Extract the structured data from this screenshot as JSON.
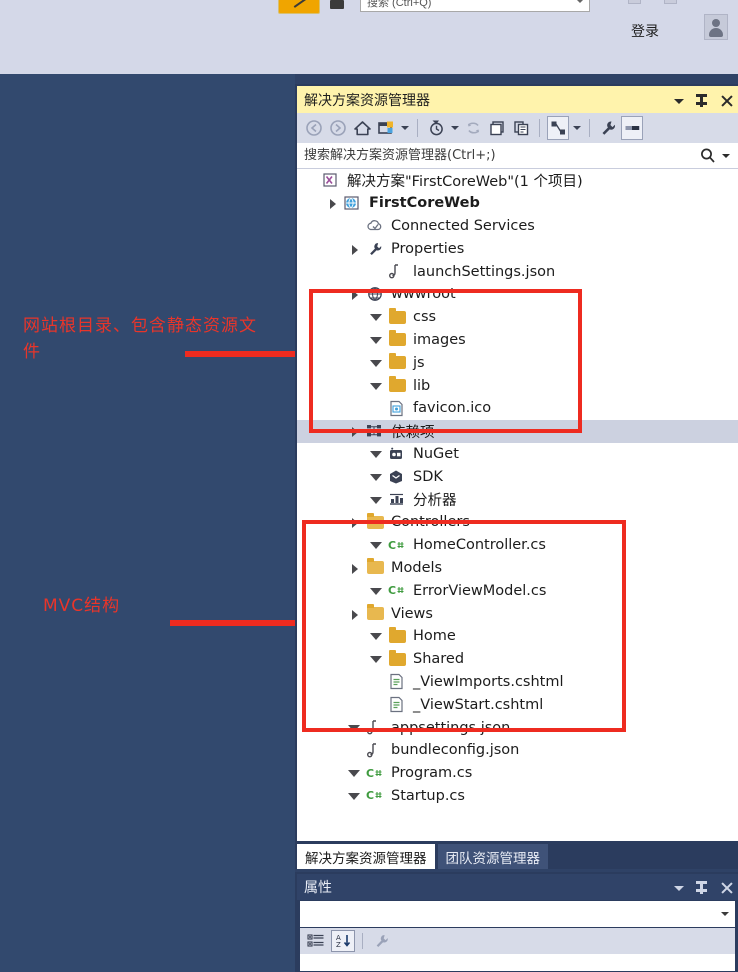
{
  "top_bar": {
    "search_value": "搜索 (Ctrl+Q)",
    "login_label": "登录",
    "account_icon": "account-person-icon"
  },
  "annotations": [
    {
      "id": "wwwroot-note",
      "text": "网站根目录、包含静态资源文件",
      "color": "#e8352a"
    },
    {
      "id": "mvc-note",
      "text": "MVC结构",
      "color": "#e8352a"
    }
  ],
  "solution_explorer": {
    "title": "解决方案资源管理器",
    "title_buttons": [
      {
        "name": "window-menu-chevron",
        "icon": "chevron-down-icon"
      },
      {
        "name": "auto-hide-pin",
        "icon": "pin-icon"
      },
      {
        "name": "close-window",
        "icon": "close-icon"
      }
    ],
    "toolbar": [
      {
        "name": "back",
        "icon": "arrow-back-icon"
      },
      {
        "name": "forward",
        "icon": "arrow-forward-icon"
      },
      {
        "name": "home",
        "icon": "home-icon"
      },
      {
        "name": "show-all-files",
        "icon": "show-all-files-icon"
      },
      {
        "name": "show-all-files-dropdown",
        "icon": "chevron-down-icon"
      },
      {
        "name": "pending-changes-filter",
        "icon": "clock-filter-icon"
      },
      {
        "name": "pending-changes-dropdown",
        "icon": "chevron-down-icon"
      },
      {
        "name": "refresh",
        "icon": "refresh-icon"
      },
      {
        "name": "collapse-all",
        "icon": "collapse-all-icon"
      },
      {
        "name": "view-code",
        "icon": "view-code-icon"
      },
      {
        "name": "preview-selected-items",
        "icon": "preview-items-icon"
      },
      {
        "name": "preview-dropdown",
        "icon": "chevron-down-icon"
      },
      {
        "name": "properties",
        "icon": "wrench-icon"
      },
      {
        "name": "properties-window",
        "icon": "properties-panel-icon"
      }
    ],
    "search_placeholder": "搜索解决方案资源管理器(Ctrl+;)",
    "search_value": "",
    "search_icon": "search-icon",
    "search_dropdown_icon": "chevron-down-icon",
    "tree": [
      {
        "label": "解决方案\"FirstCoreWeb\"(1 个项目)",
        "indent": 0,
        "toggle": "none",
        "icon": "solution-icon",
        "bold": false,
        "selected": false
      },
      {
        "label": "FirstCoreWeb",
        "indent": 1,
        "toggle": "expanded",
        "icon": "web-project-icon",
        "bold": true,
        "selected": false
      },
      {
        "label": "Connected Services",
        "indent": 2,
        "toggle": "none",
        "icon": "connected-services-icon",
        "bold": false,
        "selected": false
      },
      {
        "label": "Properties",
        "indent": 2,
        "toggle": "expanded",
        "icon": "wrench-icon",
        "bold": false,
        "selected": false
      },
      {
        "label": "launchSettings.json",
        "indent": 3,
        "toggle": "none",
        "icon": "json-file-icon",
        "bold": false,
        "selected": false
      },
      {
        "label": "wwwroot",
        "indent": 2,
        "toggle": "expanded",
        "icon": "globe-icon",
        "bold": false,
        "selected": false
      },
      {
        "label": "css",
        "indent": 3,
        "toggle": "collapsed",
        "icon": "folder-icon",
        "bold": false,
        "selected": false
      },
      {
        "label": "images",
        "indent": 3,
        "toggle": "collapsed",
        "icon": "folder-icon",
        "bold": false,
        "selected": false
      },
      {
        "label": "js",
        "indent": 3,
        "toggle": "collapsed",
        "icon": "folder-icon",
        "bold": false,
        "selected": false
      },
      {
        "label": "lib",
        "indent": 3,
        "toggle": "collapsed",
        "icon": "folder-icon",
        "bold": false,
        "selected": false
      },
      {
        "label": "favicon.ico",
        "indent": 3,
        "toggle": "none",
        "icon": "image-file-icon",
        "bold": false,
        "selected": false
      },
      {
        "label": "依赖项",
        "indent": 2,
        "toggle": "expanded",
        "icon": "dependencies-icon",
        "bold": false,
        "selected": true
      },
      {
        "label": "NuGet",
        "indent": 3,
        "toggle": "collapsed",
        "icon": "nuget-icon",
        "bold": false,
        "selected": false
      },
      {
        "label": "SDK",
        "indent": 3,
        "toggle": "collapsed",
        "icon": "sdk-icon",
        "bold": false,
        "selected": false
      },
      {
        "label": "分析器",
        "indent": 3,
        "toggle": "collapsed",
        "icon": "analyzer-icon",
        "bold": false,
        "selected": false
      },
      {
        "label": "Controllers",
        "indent": 2,
        "toggle": "expanded",
        "icon": "folder-open-icon",
        "bold": false,
        "selected": false
      },
      {
        "label": "HomeController.cs",
        "indent": 3,
        "toggle": "collapsed",
        "icon": "csharp-file-icon",
        "bold": false,
        "selected": false
      },
      {
        "label": "Models",
        "indent": 2,
        "toggle": "expanded",
        "icon": "folder-open-icon",
        "bold": false,
        "selected": false
      },
      {
        "label": "ErrorViewModel.cs",
        "indent": 3,
        "toggle": "collapsed",
        "icon": "csharp-file-icon",
        "bold": false,
        "selected": false
      },
      {
        "label": "Views",
        "indent": 2,
        "toggle": "expanded",
        "icon": "folder-open-icon",
        "bold": false,
        "selected": false
      },
      {
        "label": "Home",
        "indent": 3,
        "toggle": "collapsed",
        "icon": "folder-icon",
        "bold": false,
        "selected": false
      },
      {
        "label": "Shared",
        "indent": 3,
        "toggle": "collapsed",
        "icon": "folder-icon",
        "bold": false,
        "selected": false
      },
      {
        "label": "_ViewImports.cshtml",
        "indent": 3,
        "toggle": "none",
        "icon": "cshtml-file-icon",
        "bold": false,
        "selected": false
      },
      {
        "label": "_ViewStart.cshtml",
        "indent": 3,
        "toggle": "none",
        "icon": "cshtml-file-icon",
        "bold": false,
        "selected": false
      },
      {
        "label": "appsettings.json",
        "indent": 2,
        "toggle": "collapsed",
        "icon": "json-file-icon",
        "bold": false,
        "selected": false
      },
      {
        "label": "bundleconfig.json",
        "indent": 2,
        "toggle": "none",
        "icon": "json-file-icon",
        "bold": false,
        "selected": false
      },
      {
        "label": "Program.cs",
        "indent": 2,
        "toggle": "collapsed",
        "icon": "csharp-file-icon",
        "bold": false,
        "selected": false
      },
      {
        "label": "Startup.cs",
        "indent": 2,
        "toggle": "collapsed",
        "icon": "csharp-file-icon",
        "bold": false,
        "selected": false
      }
    ],
    "tabs": [
      {
        "label": "解决方案资源管理器",
        "active": true
      },
      {
        "label": "团队资源管理器",
        "active": false
      }
    ]
  },
  "properties_panel": {
    "title": "属性",
    "title_buttons": [
      {
        "name": "window-menu-chevron",
        "icon": "chevron-down-icon"
      },
      {
        "name": "auto-hide-pin",
        "icon": "pin-icon"
      },
      {
        "name": "close-window",
        "icon": "close-icon"
      }
    ],
    "object_selector_value": "",
    "object_selector_icon": "chevron-down-icon",
    "toolbar": [
      {
        "name": "categorized",
        "icon": "categorized-view-icon"
      },
      {
        "name": "alphabetical",
        "icon": "alphabetical-sort-icon"
      },
      {
        "name": "property-pages",
        "icon": "wrench-icon"
      }
    ]
  },
  "colors": {
    "accent_title": "#fff3ac",
    "window_chrome": "#2b3c5e",
    "backdrop": "#32496e",
    "top_strip": "#d4d8e8",
    "annotation_red": "#ee2b20",
    "folder_gold": "#e0a82e",
    "selection": "#ccd1e0"
  }
}
